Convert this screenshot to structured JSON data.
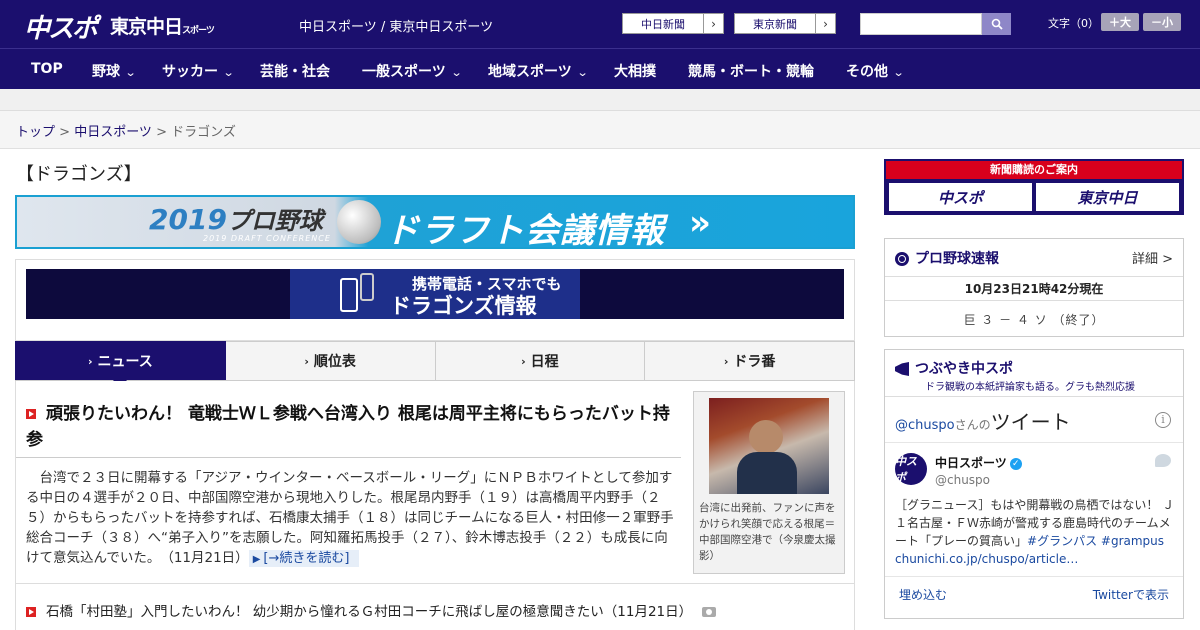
{
  "header": {
    "logo_chuspo": "中スポ",
    "logo_tokyo": "東京中日",
    "logo_tokyo_sub": "スポーツ",
    "site_links": "中日スポーツ / 東京中日スポーツ",
    "btn_chunichi": "中日新聞",
    "btn_tokyo": "東京新聞",
    "arrow": "›",
    "fontsize_label": "文字（0）",
    "font_plus": "＋大",
    "font_minus": "－小"
  },
  "nav": [
    {
      "label": "TOP"
    },
    {
      "label": "野球"
    },
    {
      "label": "サッカー"
    },
    {
      "label": "芸能・社会"
    },
    {
      "label": "一般スポーツ"
    },
    {
      "label": "地域スポーツ"
    },
    {
      "label": "大相撲"
    },
    {
      "label": "競馬・ボート・競輪"
    },
    {
      "label": "その他"
    }
  ],
  "breadcrumb": {
    "top": "トップ",
    "sep": " > ",
    "chuspo": "中日スポーツ",
    "current": "ドラゴンズ"
  },
  "page_heading": "【ドラゴンズ】",
  "draft_banner": {
    "year": "2019",
    "pro": "プロ野球",
    "sub": "2019 DRAFT CONFERENCE",
    "title": "ドラフト会議情報",
    "go": "»"
  },
  "mobile_banner": {
    "line1": "携帯電話・スマホでも",
    "line2": "ドラゴンズ情報"
  },
  "tabs": [
    {
      "label": "ニュース",
      "active": true
    },
    {
      "label": "順位表"
    },
    {
      "label": "日程"
    },
    {
      "label": "ドラ番"
    }
  ],
  "lead": {
    "title": "頑張りたいわん！ 竜戦士ＷＬ参戦へ台湾入り 根尾は周平主将にもらったバット持参",
    "body": "台湾で２３日に開幕する「アジア・ウインター・ベースボール・リーグ」にＮＰＢホワイトとして参加する中日の４選手が２０日、中部国際空港から現地入りした。根尾昂内野手（１９）は高橋周平内野手（２５）からもらったバットを持参すれば、石橋康太捕手（１８）は同じチームになる巨人・村田修一２軍野手総合コーチ（３８）へ“弟子入り”を志願した。阿知羅拓馬投手（２７）、鈴木博志投手（２２）も成長に向けて意気込んでいた。",
    "date": "（11月21日）",
    "more": "[→続きを読む]",
    "caption": "台湾に出発前、ファンに声をかけられ笑顔で応える根尾＝中部国際空港で（今泉慶太撮影）"
  },
  "news_item2": "石橋「村田塾」入門したいわん！ 幼少期から憧れるＧ村田コーチに飛ばし屋の極意聞きたい（11月21日）",
  "subscribe": {
    "header": "新聞購読のご案内",
    "chuspo": "中スポ",
    "tokyo": "東京中日"
  },
  "baseball": {
    "title": "プロ野球速報",
    "detail": "詳細 >",
    "time": "10月23日21時42分現在",
    "score": "巨 ３ － ４ ソ （終了）"
  },
  "tweets": {
    "title": "つぶやき中スポ",
    "subtitle": "ドラ観戦の本紙評論家も語る。グラも熱烈応援",
    "handle_link": "@chuspo",
    "san": "さんの",
    "tweets_word": "ツイート",
    "account_name": "中日スポーツ",
    "account_handle": "@chuspo",
    "text": "［グラニュース］もはや開幕戦の鳥栖ではない！ Ｊ１名古屋・ＦＷ赤崎が警戒する鹿島時代のチームメート「プレーの質高い」",
    "tag1": "#グランパス",
    "tag2": "#grampus",
    "link": "chunichi.co.jp/chuspo/article…",
    "embed": "埋め込む",
    "view": "Twitterで表示",
    "avatar_text": "中スポ"
  },
  "colors": {
    "brand": "#1b0f6e",
    "accent_red": "#d22",
    "banner_blue": "#1aa0d2"
  }
}
